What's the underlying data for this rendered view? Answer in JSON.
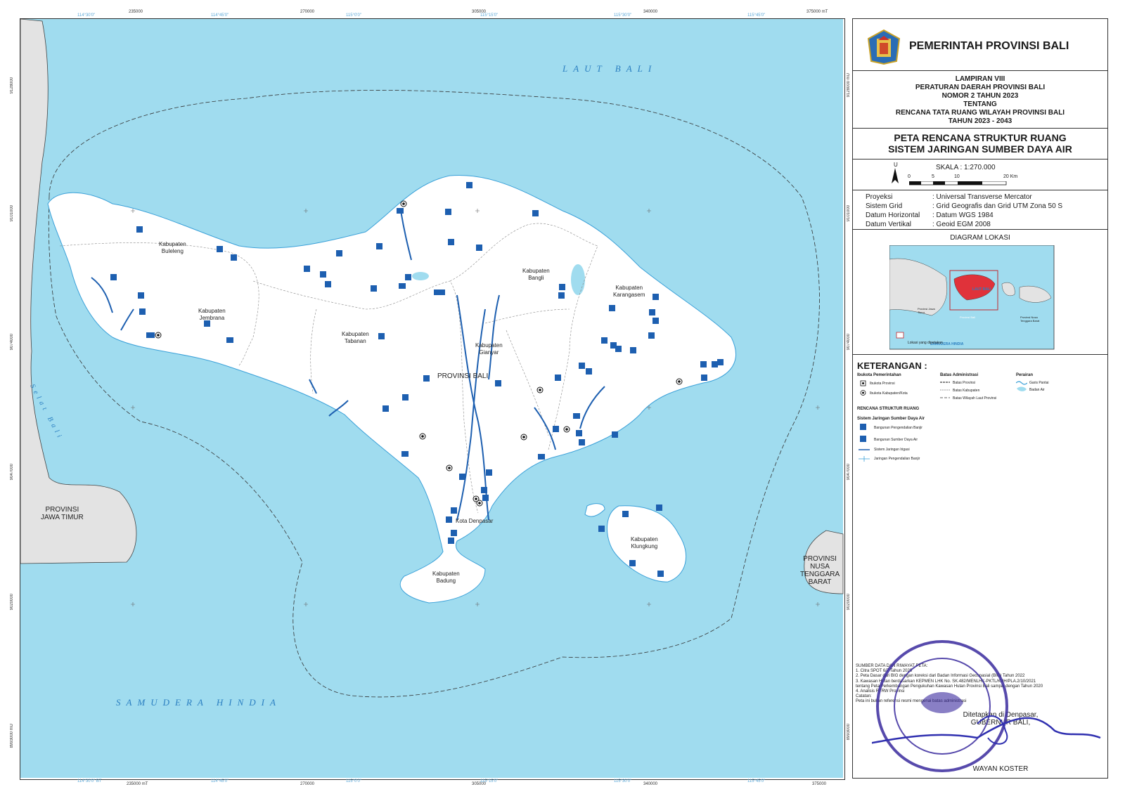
{
  "map": {
    "sea_labels": {
      "north": "LAUT BALI",
      "south": "SAMUDERA HINDIA",
      "strait": "Selat Bali"
    },
    "places": {
      "buleleng": [
        "Kabupaten",
        "Buleleng"
      ],
      "jembrana": [
        "Kabupaten",
        "Jembrana"
      ],
      "tabanan": [
        "Kabupaten",
        "Tabanan"
      ],
      "gianyar": [
        "Kabupaten",
        "Gianyar"
      ],
      "bangli": [
        "Kabupaten",
        "Bangli"
      ],
      "karangasem": [
        "Kabupaten",
        "Karangasem"
      ],
      "klungkung": [
        "Kabupaten",
        "Klungkung"
      ],
      "badung": [
        "Kabupaten",
        "Badung"
      ],
      "denpasar": "Kota Denpasar",
      "provinsi_bali": "PROVINSI BALI",
      "jatim": [
        "PROVINSI",
        "JAWA TIMUR"
      ],
      "ntb": [
        "PROVINSI",
        "NUSA",
        "TENGGARA",
        "BARAT"
      ]
    },
    "ticks_top": [
      "235000",
      "270000",
      "305000",
      "340000",
      "375000 mT"
    ],
    "ticks_top_geo": [
      "114°30'0\"",
      "114°45'0\"",
      "115°0'0\"",
      "115°15'0\"",
      "115°30'0\"",
      "115°45'0\""
    ],
    "ticks_bottom": [
      "235000 mT",
      "270000",
      "305000",
      "340000",
      "375000"
    ],
    "ticks_bottom_geo": [
      "114°30'0\" BT",
      "114°45'0\"",
      "115°0'0\"",
      "115°15'0\"",
      "115°30'0\"",
      "115°45'0\""
    ],
    "ticks_left": [
      "9128000",
      "9101000",
      "9074000",
      "9047000",
      "9020000",
      "8993000 mU"
    ],
    "ticks_right": [
      "9128000 mU",
      "9101000",
      "9074000",
      "9047000",
      "9020000",
      "8993000"
    ]
  },
  "panel": {
    "gov_title": "PEMERINTAH PROVINSI BALI",
    "lampiran": [
      "LAMPIRAN VIII",
      "PERATURAN DAERAH PROVINSI BALI",
      "NOMOR 2  TAHUN 2023",
      "TENTANG",
      "RENCANA TATA RUANG WILAYAH PROVINSI BALI",
      "TAHUN 2023 - 2043"
    ],
    "map_title": [
      "PETA RENCANA STRUKTUR RUANG",
      "SISTEM JARINGAN SUMBER DAYA AIR"
    ],
    "north": "U",
    "scale_text": "SKALA :  1:270.000",
    "scale_ticks": [
      "0",
      "5",
      "10",
      "20 Km"
    ],
    "projection": [
      {
        "k": "Proyeksi",
        "v": ": Universal Transverse Mercator"
      },
      {
        "k": "Sistem Grid",
        "v": ": Grid Geografis dan Grid UTM Zona 50 S"
      },
      {
        "k": "Datum Horizontal",
        "v": ": Datum WGS 1984"
      },
      {
        "k": "Datum Vertikal",
        "v": ": Geoid EGM 2008"
      }
    ],
    "diagram_title": "DIAGRAM LOKASI",
    "diagram_labels": {
      "laut": "LAUT BALI",
      "samudera": "SAMUDERA HINDIA",
      "box": "Lokasi yang dipetakan",
      "jatim": "Provinsi Jawa Timur",
      "bali": "Provinsi Bali",
      "ntb": "Provinsi Nusa Tenggara Barat"
    },
    "legend": {
      "title": "KETERANGAN :",
      "ibukota_h": "Ibukota Pemerintahan",
      "ibukota": [
        "Ibukota Provinsi",
        "Ibukota Kabupaten/Kota"
      ],
      "batas_h": "Batas Administrasi",
      "batas": [
        "Batas Provinsi",
        "Batas Kabupaten",
        "Batas Wilayah Laut Provinsi"
      ],
      "perairan_h": "Perairan",
      "perairan": [
        "Garis Pantai",
        "Badan Air"
      ],
      "rencana_h": "RENCANA STRUKTUR RUANG",
      "sistem_h": "Sistem Jaringan Sumber Daya Air",
      "sistem": [
        "Bangunan Pengendalian Banjir",
        "Bangunan Sumber Daya Air",
        "Sistem Jaringan Irigasi",
        "Jaringan Pengendalian Banjir"
      ]
    },
    "sources": [
      "SUMBER DATA DAN RIWAYAT PETA:",
      "1. Citra SPOT 6/7 Tahun 2020",
      "2. Peta Dasar dari BIG dengan koreksi dari Badan Informasi Geospasial (BIG) Tahun 2022",
      "3. Kawasan Hutan berdasarkan KEPMEN LHK No. SK.482/MENLHK-PKTL/KUH/PLA.2/10/2021",
      "    tentang Peta Perkembangan Pengukuhan Kawasan Hutan Provinsi Bali sampai dengan Tahun 2020",
      "4. Analisis RTRW Provinsi",
      "Catatan:",
      "Peta ini bukan referensi resmi mengenai batas administrasi"
    ],
    "sign": {
      "line1": "Ditetapkan di Denpasar,",
      "line2": "GUBERNUR BALI,",
      "name": "WAYAN KOSTER"
    },
    "stamp": "GUBERNUR"
  }
}
